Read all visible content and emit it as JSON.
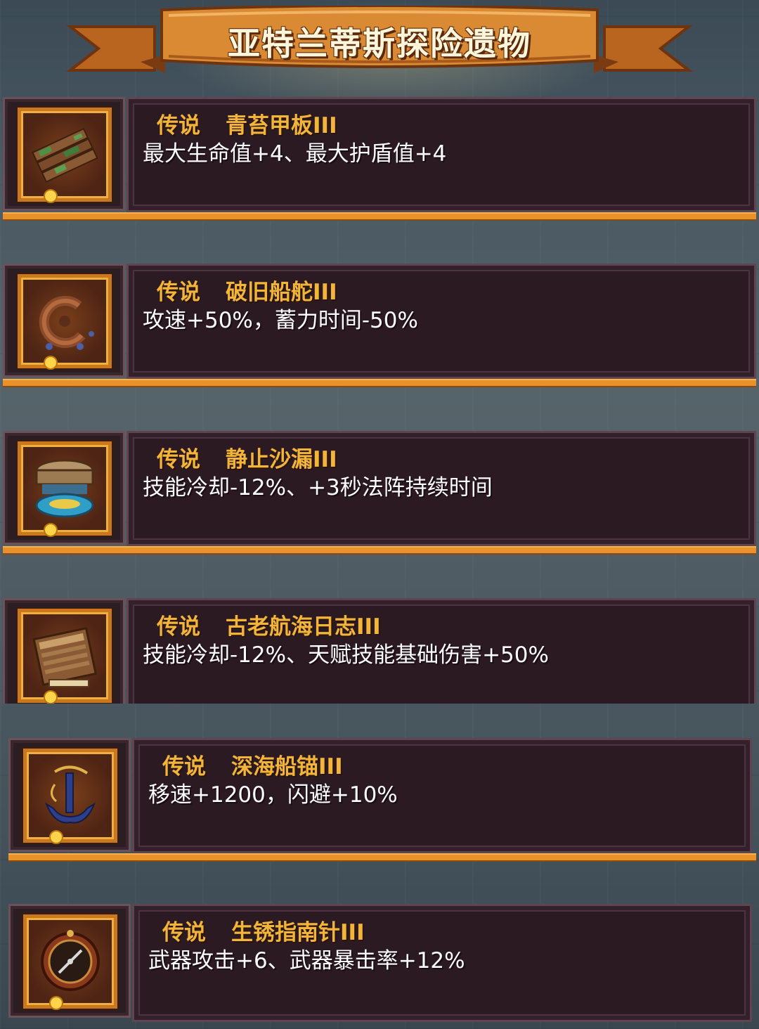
{
  "title": "亚特兰蒂斯探险遗物",
  "colors": {
    "rarity_text": "#f2b53a",
    "banner": "#d98a32",
    "panel_bg": "#2c1a23",
    "accent_bar": "#e9912a"
  },
  "relics": [
    {
      "rarity": "传说",
      "name": "青苔甲板III",
      "effect": "最大生命值+4、最大护盾值+4",
      "icon": "moss-plank-icon"
    },
    {
      "rarity": "传说",
      "name": "破旧船舵III",
      "effect": "攻速+50%，蓄力时间-50%",
      "icon": "broken-helm-icon"
    },
    {
      "rarity": "传说",
      "name": "静止沙漏III",
      "effect": "技能冷却-12%、+3秒法阵持续时间",
      "icon": "hourglass-icon"
    },
    {
      "rarity": "传说",
      "name": "古老航海日志III",
      "effect": "技能冷却-12%、天赋技能基础伤害+50%",
      "icon": "logbook-icon"
    },
    {
      "rarity": "传说",
      "name": "深海船锚III",
      "effect": "移速+1200，闪避+10%",
      "icon": "anchor-icon"
    },
    {
      "rarity": "传说",
      "name": "生锈指南针III",
      "effect": "武器攻击+6、武器暴击率+12%",
      "icon": "compass-icon"
    }
  ]
}
